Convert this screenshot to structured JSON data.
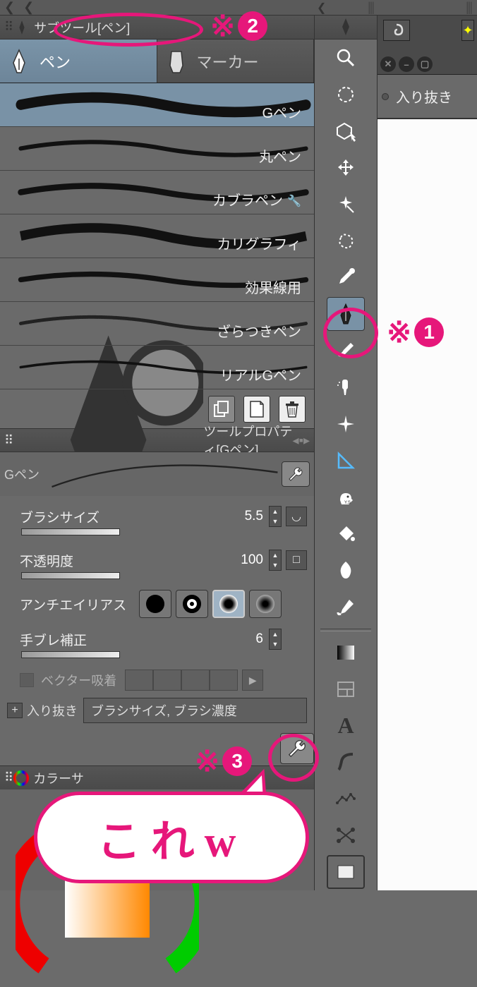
{
  "subtool_panel": {
    "title": "サブツール[ペン]",
    "tabs": [
      {
        "label": "ペン",
        "active": true
      },
      {
        "label": "マーカー",
        "active": false
      }
    ],
    "brushes": [
      {
        "name": "Gペン",
        "active": true
      },
      {
        "name": "丸ペン"
      },
      {
        "name": "カブラペン",
        "locked": true
      },
      {
        "name": "カリグラフィ"
      },
      {
        "name": "効果線用"
      },
      {
        "name": "ざらつきペン"
      },
      {
        "name": "リアルGペン"
      }
    ]
  },
  "tool_property": {
    "title": "ツールプロパティ[Gペン]",
    "preview_label": "Gペン",
    "rows": {
      "brush_size_label": "ブラシサイズ",
      "brush_size_value": "5.5",
      "opacity_label": "不透明度",
      "opacity_value": "100",
      "antialias_label": "アンチエイリアス",
      "stabilize_label": "手ブレ補正",
      "stabilize_value": "6",
      "vector_label": "ベクター吸着",
      "inout_label": "入り抜き",
      "inout_value": "ブラシサイズ, ブラシ濃度"
    }
  },
  "color_panel": {
    "title": "カラーサ"
  },
  "right_doc": {
    "label": "入り抜き"
  },
  "annotations": {
    "a1": "※",
    "a2": "※",
    "a3": "※",
    "n1": "1",
    "n2": "2",
    "n3": "3",
    "speech": "これw"
  }
}
